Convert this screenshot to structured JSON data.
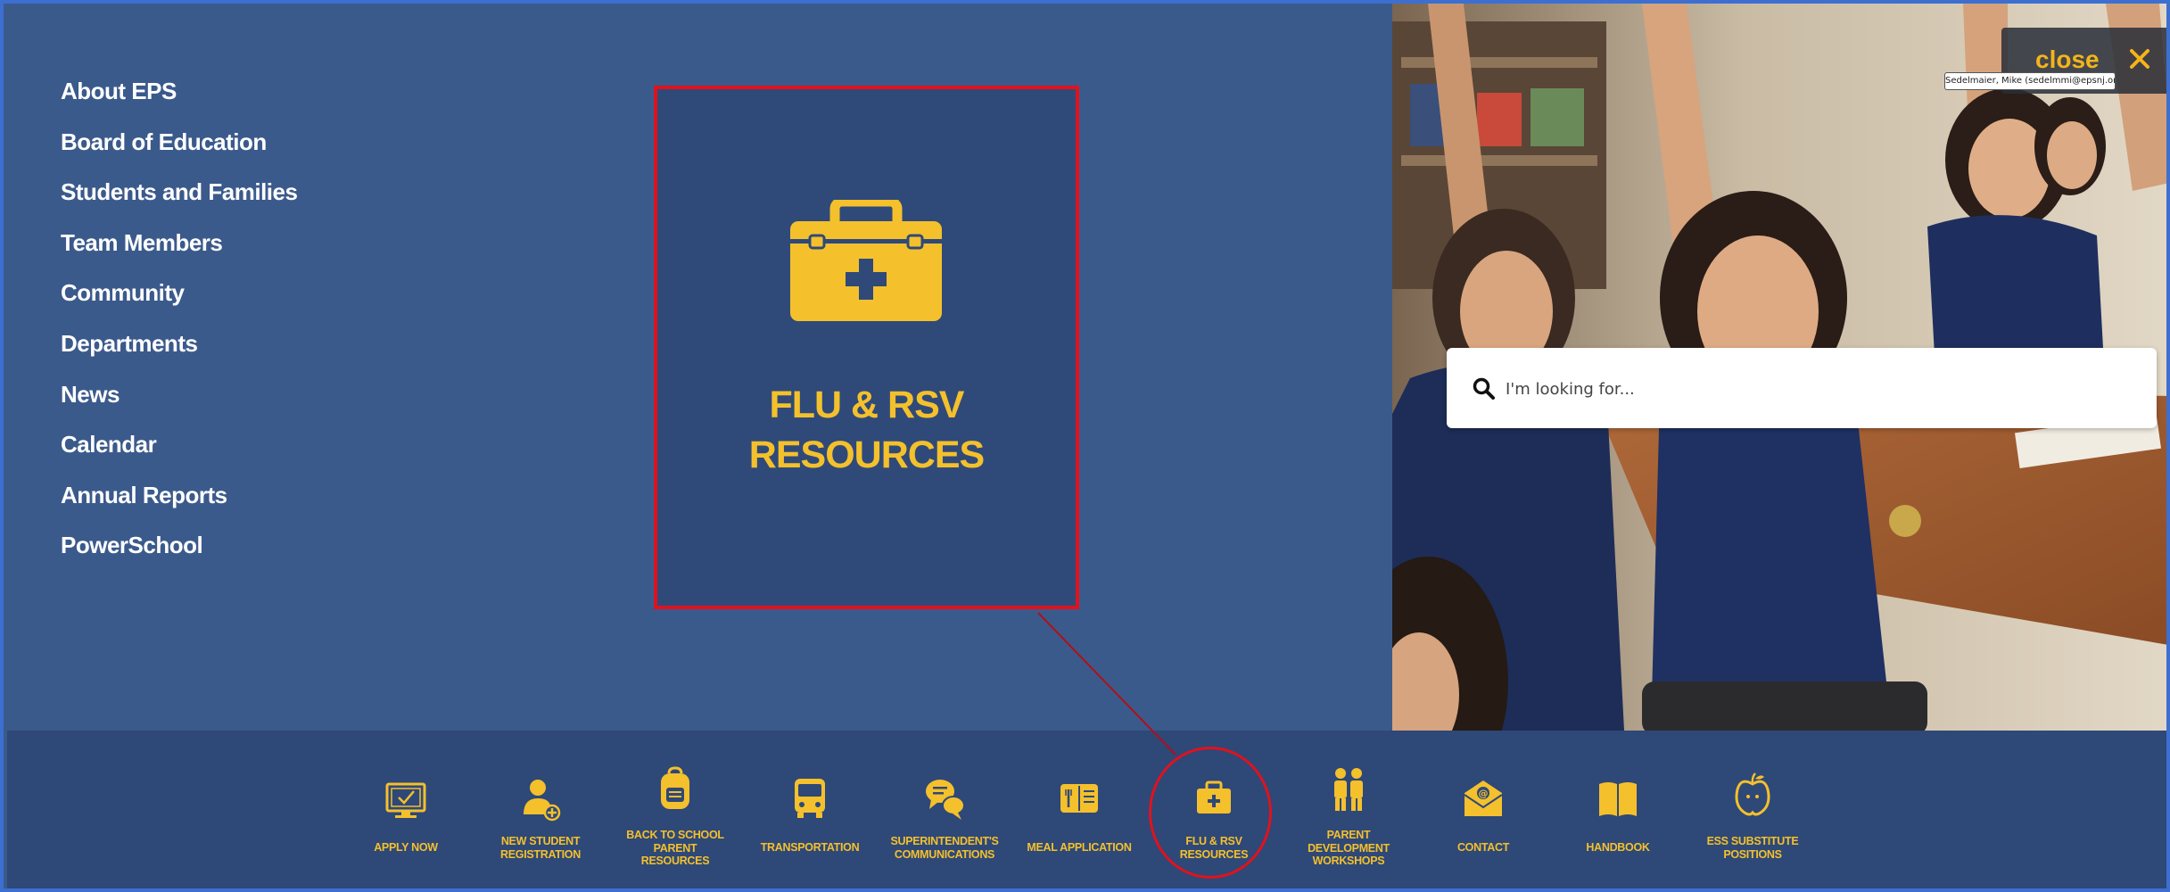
{
  "nav": {
    "items": [
      {
        "label": "About EPS"
      },
      {
        "label": "Board of Education"
      },
      {
        "label": "Students and Families"
      },
      {
        "label": "Team Members"
      },
      {
        "label": "Community"
      },
      {
        "label": "Departments"
      },
      {
        "label": "News"
      },
      {
        "label": "Calendar"
      },
      {
        "label": "Annual Reports"
      },
      {
        "label": "PowerSchool"
      }
    ]
  },
  "feature": {
    "title": "FLU & RSV\nRESOURCES",
    "icon": "first-aid-kit-icon"
  },
  "search": {
    "placeholder": "I'm looking for..."
  },
  "close": {
    "label": "close"
  },
  "tooltip": {
    "text": "Sedelmaier, Mike (sedelmmi@epsnj.org)"
  },
  "quick_links": [
    {
      "label": "APPLY NOW",
      "icon": "monitor-check-icon"
    },
    {
      "label": "NEW STUDENT\nREGISTRATION",
      "icon": "add-user-icon"
    },
    {
      "label": "BACK TO SCHOOL\nPARENT\nRESOURCES",
      "icon": "backpack-icon"
    },
    {
      "label": "TRANSPORTATION",
      "icon": "bus-icon"
    },
    {
      "label": "SUPERINTENDENT'S\nCOMMUNICATIONS",
      "icon": "chat-bubbles-icon"
    },
    {
      "label": "MEAL APPLICATION",
      "icon": "meal-menu-icon"
    },
    {
      "label": "FLU & RSV\nRESOURCES",
      "icon": "first-aid-kit-icon"
    },
    {
      "label": "PARENT\nDEVELOPMENT\nWORKSHOPS",
      "icon": "parent-child-icon"
    },
    {
      "label": "CONTACT",
      "icon": "email-icon"
    },
    {
      "label": "HANDBOOK",
      "icon": "book-icon"
    },
    {
      "label": "ESS SUBSTITUTE\nPOSITIONS",
      "icon": "apple-icon"
    }
  ],
  "colors": {
    "accent": "#f4c02c",
    "background": "#3b5a8c",
    "bar": "#2e4878",
    "highlight": "#e0121c"
  }
}
